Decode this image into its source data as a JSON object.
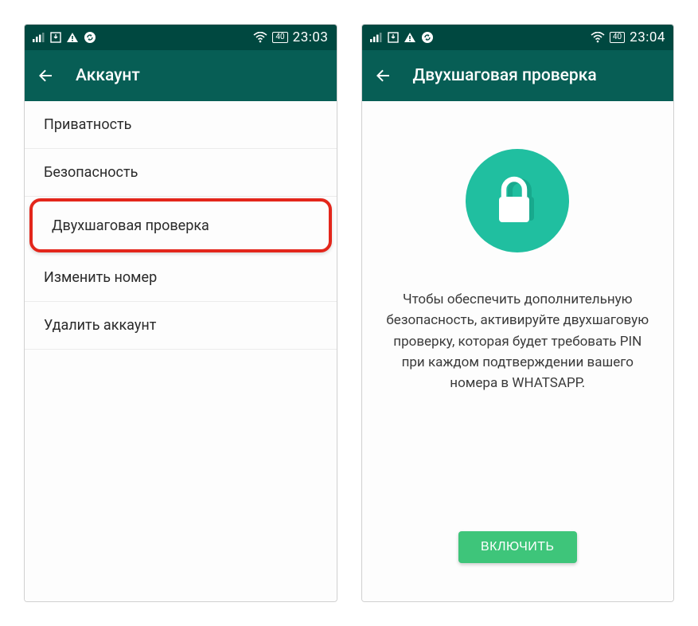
{
  "status": {
    "time": "23:03",
    "battery_label": "40"
  },
  "status2": {
    "time": "23:04",
    "battery_label": "40"
  },
  "left_screen": {
    "title": "Аккаунт",
    "items": [
      {
        "label": "Приватность"
      },
      {
        "label": "Безопасность"
      },
      {
        "label": "Двухшаговая проверка"
      },
      {
        "label": "Изменить номер"
      },
      {
        "label": "Удалить аккаунт"
      }
    ]
  },
  "right_screen": {
    "title": "Двухшаговая проверка",
    "description": "Чтобы обеспечить дополнительную безопасность, активируйте двухшаговую проверку, которая будет требовать PIN при каждом подтверждении вашего номера в WHATSAPP.",
    "enable_label": "ВКЛЮЧИТЬ"
  }
}
